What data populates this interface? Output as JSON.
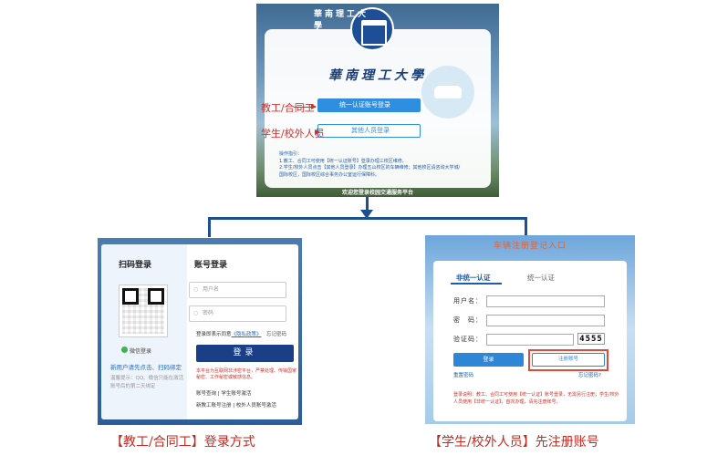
{
  "top": {
    "logo_text": "華南理工大學",
    "uni_name": "華南理工大學",
    "btn_unified": "统一认证账号登录",
    "btn_other": "其他人员登录",
    "label_staff": "教工/合同工",
    "label_student": "学生/校外人员",
    "instructions": "操作指引：\n1.教工、合同工可使用【统一认证账号】登录办理三校区维修。\n2.学生/校外人员点击【其他人员登录】办理五山校区的车辆维修；其他校区请咨询大学城/国际校区，国际校区综合事务办公室运行保障科。",
    "welcome": "欢迎您登录校园交通服务平台"
  },
  "left": {
    "qr_title": "扫码登录",
    "wechat_label": "微信登录",
    "new_user": "新用户请先点击、扫码绑定",
    "tip": "温馨提示：QQ、微信只能在激活账号后的第二天绑定",
    "account_title": "账号登录",
    "username_placeholder": "用户名",
    "password_placeholder": "密码",
    "agree_prefix": "登录即表示同意",
    "privacy": "《隐私政策》",
    "forgot": "忘记密码",
    "login": "登录",
    "warning": "本平台为互联网非涉密平台，严禁处理、传输国家秘密、工作秘密或敏感信息。",
    "query": "账号查询 | 学生账号激活",
    "register": "新教工账号注册 | 校外人员账号激活",
    "caption": "【教工/合同工】登录方式"
  },
  "right": {
    "title": "车辆注册登记入口",
    "tab_active": "非统一认证",
    "tab_inactive": "统一认证",
    "username_label": "用户名：",
    "password_label": "密　码：",
    "captcha_label": "验证码：",
    "captcha_value": "4555",
    "login": "登录",
    "register": "注册账号",
    "reset": "重置密码",
    "forgot": "忘记密码?",
    "note": "登录说明：教工、合同工可使用【统一认证】账号登录，无需另行注册；学生/校外人员使用【非统一认证】，首次办理，请先注册账号。",
    "caption": "【学生/校外人员】先注册账号"
  },
  "colors": {
    "accent": "#2f8ee0",
    "navy": "#1e4f8f",
    "red": "#c8281f"
  }
}
